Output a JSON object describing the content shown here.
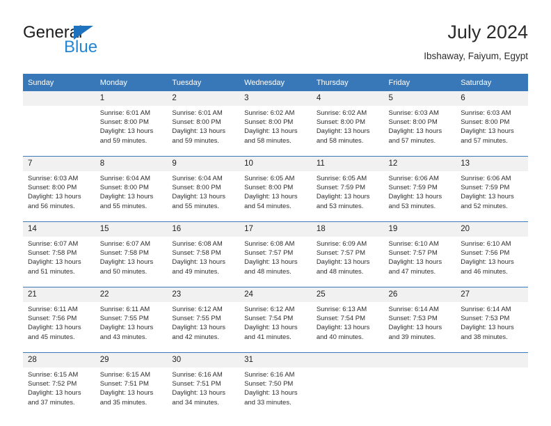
{
  "brand": {
    "name_part1": "General",
    "name_part2": "Blue",
    "triangle_color": "#1f72bd",
    "blue_color": "#2585d3"
  },
  "header": {
    "title": "July 2024",
    "subtitle": "Ibshaway, Faiyum, Egypt"
  },
  "theme": {
    "header_bg": "#3878b9",
    "daynum_bg": "#f1f1f1",
    "grid_line": "#3878b9",
    "text": "#2d2d2d"
  },
  "weekday_headers": [
    "Sunday",
    "Monday",
    "Tuesday",
    "Wednesday",
    "Thursday",
    "Friday",
    "Saturday"
  ],
  "weeks": [
    {
      "days": [
        {
          "num": "",
          "sunrise": "",
          "sunset": "",
          "daylight1": "",
          "daylight2": ""
        },
        {
          "num": "1",
          "sunrise": "Sunrise: 6:01 AM",
          "sunset": "Sunset: 8:00 PM",
          "daylight1": "Daylight: 13 hours",
          "daylight2": "and 59 minutes."
        },
        {
          "num": "2",
          "sunrise": "Sunrise: 6:01 AM",
          "sunset": "Sunset: 8:00 PM",
          "daylight1": "Daylight: 13 hours",
          "daylight2": "and 59 minutes."
        },
        {
          "num": "3",
          "sunrise": "Sunrise: 6:02 AM",
          "sunset": "Sunset: 8:00 PM",
          "daylight1": "Daylight: 13 hours",
          "daylight2": "and 58 minutes."
        },
        {
          "num": "4",
          "sunrise": "Sunrise: 6:02 AM",
          "sunset": "Sunset: 8:00 PM",
          "daylight1": "Daylight: 13 hours",
          "daylight2": "and 58 minutes."
        },
        {
          "num": "5",
          "sunrise": "Sunrise: 6:03 AM",
          "sunset": "Sunset: 8:00 PM",
          "daylight1": "Daylight: 13 hours",
          "daylight2": "and 57 minutes."
        },
        {
          "num": "6",
          "sunrise": "Sunrise: 6:03 AM",
          "sunset": "Sunset: 8:00 PM",
          "daylight1": "Daylight: 13 hours",
          "daylight2": "and 57 minutes."
        }
      ]
    },
    {
      "days": [
        {
          "num": "7",
          "sunrise": "Sunrise: 6:03 AM",
          "sunset": "Sunset: 8:00 PM",
          "daylight1": "Daylight: 13 hours",
          "daylight2": "and 56 minutes."
        },
        {
          "num": "8",
          "sunrise": "Sunrise: 6:04 AM",
          "sunset": "Sunset: 8:00 PM",
          "daylight1": "Daylight: 13 hours",
          "daylight2": "and 55 minutes."
        },
        {
          "num": "9",
          "sunrise": "Sunrise: 6:04 AM",
          "sunset": "Sunset: 8:00 PM",
          "daylight1": "Daylight: 13 hours",
          "daylight2": "and 55 minutes."
        },
        {
          "num": "10",
          "sunrise": "Sunrise: 6:05 AM",
          "sunset": "Sunset: 8:00 PM",
          "daylight1": "Daylight: 13 hours",
          "daylight2": "and 54 minutes."
        },
        {
          "num": "11",
          "sunrise": "Sunrise: 6:05 AM",
          "sunset": "Sunset: 7:59 PM",
          "daylight1": "Daylight: 13 hours",
          "daylight2": "and 53 minutes."
        },
        {
          "num": "12",
          "sunrise": "Sunrise: 6:06 AM",
          "sunset": "Sunset: 7:59 PM",
          "daylight1": "Daylight: 13 hours",
          "daylight2": "and 53 minutes."
        },
        {
          "num": "13",
          "sunrise": "Sunrise: 6:06 AM",
          "sunset": "Sunset: 7:59 PM",
          "daylight1": "Daylight: 13 hours",
          "daylight2": "and 52 minutes."
        }
      ]
    },
    {
      "days": [
        {
          "num": "14",
          "sunrise": "Sunrise: 6:07 AM",
          "sunset": "Sunset: 7:58 PM",
          "daylight1": "Daylight: 13 hours",
          "daylight2": "and 51 minutes."
        },
        {
          "num": "15",
          "sunrise": "Sunrise: 6:07 AM",
          "sunset": "Sunset: 7:58 PM",
          "daylight1": "Daylight: 13 hours",
          "daylight2": "and 50 minutes."
        },
        {
          "num": "16",
          "sunrise": "Sunrise: 6:08 AM",
          "sunset": "Sunset: 7:58 PM",
          "daylight1": "Daylight: 13 hours",
          "daylight2": "and 49 minutes."
        },
        {
          "num": "17",
          "sunrise": "Sunrise: 6:08 AM",
          "sunset": "Sunset: 7:57 PM",
          "daylight1": "Daylight: 13 hours",
          "daylight2": "and 48 minutes."
        },
        {
          "num": "18",
          "sunrise": "Sunrise: 6:09 AM",
          "sunset": "Sunset: 7:57 PM",
          "daylight1": "Daylight: 13 hours",
          "daylight2": "and 48 minutes."
        },
        {
          "num": "19",
          "sunrise": "Sunrise: 6:10 AM",
          "sunset": "Sunset: 7:57 PM",
          "daylight1": "Daylight: 13 hours",
          "daylight2": "and 47 minutes."
        },
        {
          "num": "20",
          "sunrise": "Sunrise: 6:10 AM",
          "sunset": "Sunset: 7:56 PM",
          "daylight1": "Daylight: 13 hours",
          "daylight2": "and 46 minutes."
        }
      ]
    },
    {
      "days": [
        {
          "num": "21",
          "sunrise": "Sunrise: 6:11 AM",
          "sunset": "Sunset: 7:56 PM",
          "daylight1": "Daylight: 13 hours",
          "daylight2": "and 45 minutes."
        },
        {
          "num": "22",
          "sunrise": "Sunrise: 6:11 AM",
          "sunset": "Sunset: 7:55 PM",
          "daylight1": "Daylight: 13 hours",
          "daylight2": "and 43 minutes."
        },
        {
          "num": "23",
          "sunrise": "Sunrise: 6:12 AM",
          "sunset": "Sunset: 7:55 PM",
          "daylight1": "Daylight: 13 hours",
          "daylight2": "and 42 minutes."
        },
        {
          "num": "24",
          "sunrise": "Sunrise: 6:12 AM",
          "sunset": "Sunset: 7:54 PM",
          "daylight1": "Daylight: 13 hours",
          "daylight2": "and 41 minutes."
        },
        {
          "num": "25",
          "sunrise": "Sunrise: 6:13 AM",
          "sunset": "Sunset: 7:54 PM",
          "daylight1": "Daylight: 13 hours",
          "daylight2": "and 40 minutes."
        },
        {
          "num": "26",
          "sunrise": "Sunrise: 6:14 AM",
          "sunset": "Sunset: 7:53 PM",
          "daylight1": "Daylight: 13 hours",
          "daylight2": "and 39 minutes."
        },
        {
          "num": "27",
          "sunrise": "Sunrise: 6:14 AM",
          "sunset": "Sunset: 7:53 PM",
          "daylight1": "Daylight: 13 hours",
          "daylight2": "and 38 minutes."
        }
      ]
    },
    {
      "days": [
        {
          "num": "28",
          "sunrise": "Sunrise: 6:15 AM",
          "sunset": "Sunset: 7:52 PM",
          "daylight1": "Daylight: 13 hours",
          "daylight2": "and 37 minutes."
        },
        {
          "num": "29",
          "sunrise": "Sunrise: 6:15 AM",
          "sunset": "Sunset: 7:51 PM",
          "daylight1": "Daylight: 13 hours",
          "daylight2": "and 35 minutes."
        },
        {
          "num": "30",
          "sunrise": "Sunrise: 6:16 AM",
          "sunset": "Sunset: 7:51 PM",
          "daylight1": "Daylight: 13 hours",
          "daylight2": "and 34 minutes."
        },
        {
          "num": "31",
          "sunrise": "Sunrise: 6:16 AM",
          "sunset": "Sunset: 7:50 PM",
          "daylight1": "Daylight: 13 hours",
          "daylight2": "and 33 minutes."
        },
        {
          "num": "",
          "sunrise": "",
          "sunset": "",
          "daylight1": "",
          "daylight2": ""
        },
        {
          "num": "",
          "sunrise": "",
          "sunset": "",
          "daylight1": "",
          "daylight2": ""
        },
        {
          "num": "",
          "sunrise": "",
          "sunset": "",
          "daylight1": "",
          "daylight2": ""
        }
      ]
    }
  ]
}
